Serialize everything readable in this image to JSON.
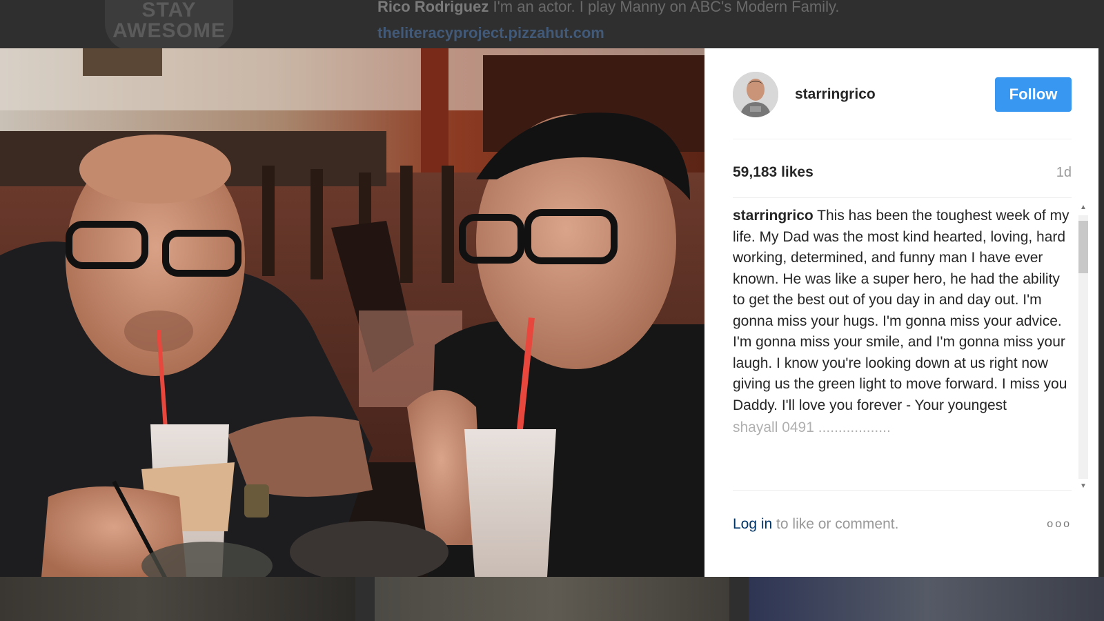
{
  "background": {
    "logo_text": "STAY AWESOME",
    "bio_name": "Rico Rodriguez",
    "bio_text": "I'm an actor. I play Manny on ABC's Modern Family.",
    "bio_link": "theliteracyproject.pizzahut.com"
  },
  "post": {
    "username": "starringrico",
    "follow_label": "Follow",
    "likes": "59,183 likes",
    "time_ago": "1d",
    "caption": {
      "user": "starringrico",
      "text": "This has been the toughest week of my life. My Dad was the most kind hearted, loving, hard working, determined, and funny man I have ever known. He was like a super hero, he had the ability to get the best out of you day in and day out. I'm gonna miss your hugs. I'm gonna miss your advice. I'm gonna miss your smile, and I'm gonna miss your laugh. I know you're looking down at us right now giving us the green light to move forward. I miss you Daddy. I'll love you forever - Your youngest"
    },
    "next_comment_partial": "shayall 0491 ..................",
    "footer": {
      "login_link": "Log in",
      "login_rest": " to like or comment.",
      "more_label": "ooo"
    }
  },
  "colors": {
    "follow_button": "#3897f0",
    "link": "#003569",
    "muted_text": "#999999"
  }
}
